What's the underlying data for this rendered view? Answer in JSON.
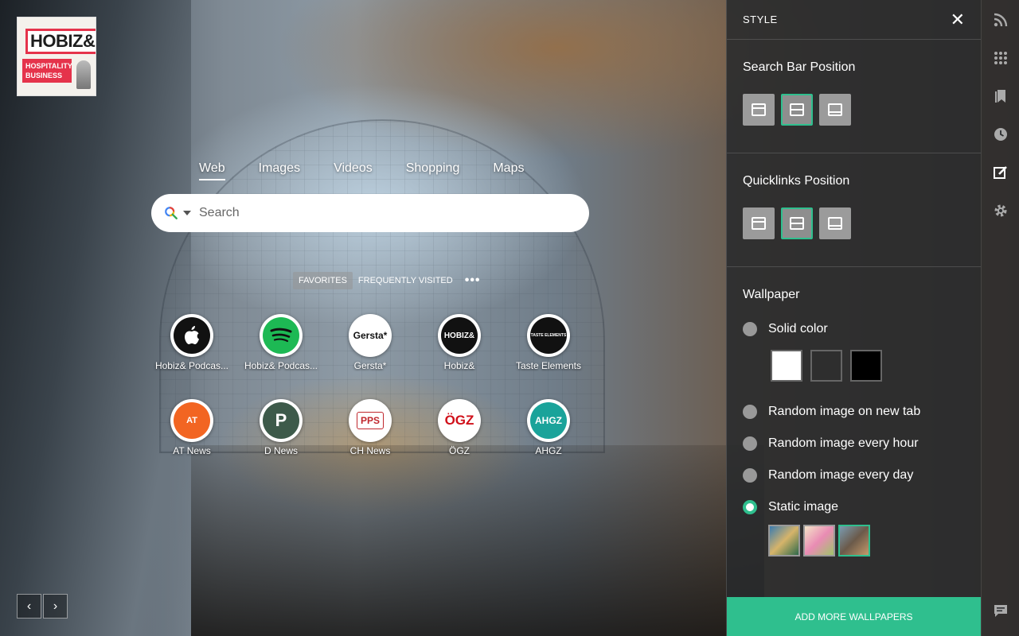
{
  "logo": {
    "line1": "HOBIZ&",
    "line2": "HOSPITALITY BUSINESS"
  },
  "search_tabs": [
    {
      "label": "Web",
      "active": true
    },
    {
      "label": "Images"
    },
    {
      "label": "Videos"
    },
    {
      "label": "Shopping"
    },
    {
      "label": "Maps"
    }
  ],
  "search": {
    "placeholder": "Search"
  },
  "quicklink_tabs": {
    "favorites": "FAVORITES",
    "frequent": "FREQUENTLY VISITED",
    "more": "•••"
  },
  "tiles": [
    {
      "label": "Hobiz& Podcas...",
      "icon": "apple-podcasts-icon"
    },
    {
      "label": "Hobiz& Podcas...",
      "icon": "spotify-icon"
    },
    {
      "label": "Gersta*",
      "icon_text": "Gersta*"
    },
    {
      "label": "Hobiz&",
      "icon_text": "HOBIZ&"
    },
    {
      "label": "Taste Elements",
      "icon_text": "TASTE ELEMENTS"
    },
    {
      "label": "AT News",
      "icon_text": "AT"
    },
    {
      "label": "D News",
      "icon_text": "P"
    },
    {
      "label": "CH News",
      "icon_text": "PPS"
    },
    {
      "label": "ÖGZ",
      "icon_text": "ÖGZ"
    },
    {
      "label": "AHGZ",
      "icon_text": "AHGZ"
    }
  ],
  "panel": {
    "title": "STYLE",
    "close": "✕",
    "search_bar_position": "Search Bar Position",
    "quicklinks_position": "Quicklinks Position",
    "wallpaper": "Wallpaper",
    "options": {
      "solid": "Solid color",
      "random_tab": "Random image on new tab",
      "random_hour": "Random image every hour",
      "random_day": "Random image every day",
      "static": "Static image"
    },
    "add_button": "ADD MORE WALLPAPERS"
  },
  "colors": {
    "accent": "#2fbf8e"
  }
}
